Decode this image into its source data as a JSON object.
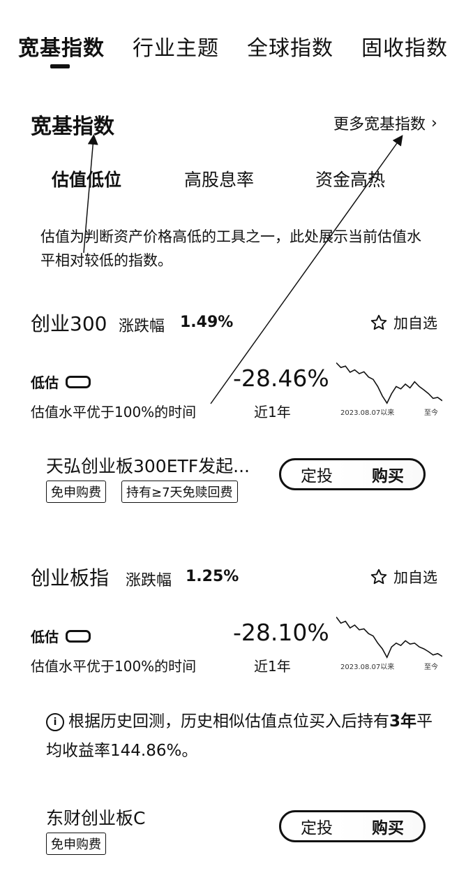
{
  "top_tabs": [
    "宽基指数",
    "行业主题",
    "全球指数",
    "固收指数"
  ],
  "section": {
    "title": "宽基指数",
    "more": "更多宽基指数"
  },
  "sub_tabs": [
    "估值低位",
    "高股息率",
    "资金高热"
  ],
  "description": "估值为判断资产价格高低的工具之一，此处展示当前估值水平相对较低的指数。",
  "indices": [
    {
      "name": "创业300",
      "change_label": "涨跌幅",
      "change_value": "1.49%",
      "fav_label": "加自选",
      "valuation_label": "低估",
      "valuation_text": "估值水平优于100%的时间",
      "return_value": "-28.46%",
      "return_period": "近1年",
      "chart_start": "2023.08.07以来",
      "chart_end": "至今",
      "spark": [
        0.05,
        0.15,
        0.12,
        0.25,
        0.2,
        0.28,
        0.24,
        0.35,
        0.4,
        0.55,
        0.75,
        0.9,
        0.7,
        0.55,
        0.6,
        0.5,
        0.58,
        0.45,
        0.55,
        0.62,
        0.7,
        0.8,
        0.78,
        0.85
      ]
    },
    {
      "name": "创业板指",
      "change_label": "涨跌幅",
      "change_value": "1.25%",
      "fav_label": "加自选",
      "valuation_label": "低估",
      "valuation_text": "估值水平优于100%的时间",
      "return_value": "-28.10%",
      "return_period": "近1年",
      "chart_start": "2023.08.07以来",
      "chart_end": "至今",
      "spark": [
        0.05,
        0.18,
        0.14,
        0.28,
        0.22,
        0.32,
        0.3,
        0.4,
        0.45,
        0.6,
        0.72,
        0.9,
        0.68,
        0.6,
        0.65,
        0.55,
        0.62,
        0.6,
        0.68,
        0.72,
        0.78,
        0.85,
        0.82,
        0.88
      ]
    }
  ],
  "funds": [
    {
      "name": "天弘创业板300ETF发起...",
      "tags": [
        "免申购费",
        "持有≥7天免赎回费"
      ],
      "btn_left": "定投",
      "btn_right": "购买"
    },
    {
      "name": "东财创业板C",
      "tags": [
        "免申购费"
      ],
      "btn_left": "定投",
      "btn_right": "购买"
    }
  ],
  "tip": {
    "prefix": "根据历史回测，历史相似估值点位买入后持有",
    "bold": "3年",
    "suffix": "平均收益率144.86%。"
  }
}
